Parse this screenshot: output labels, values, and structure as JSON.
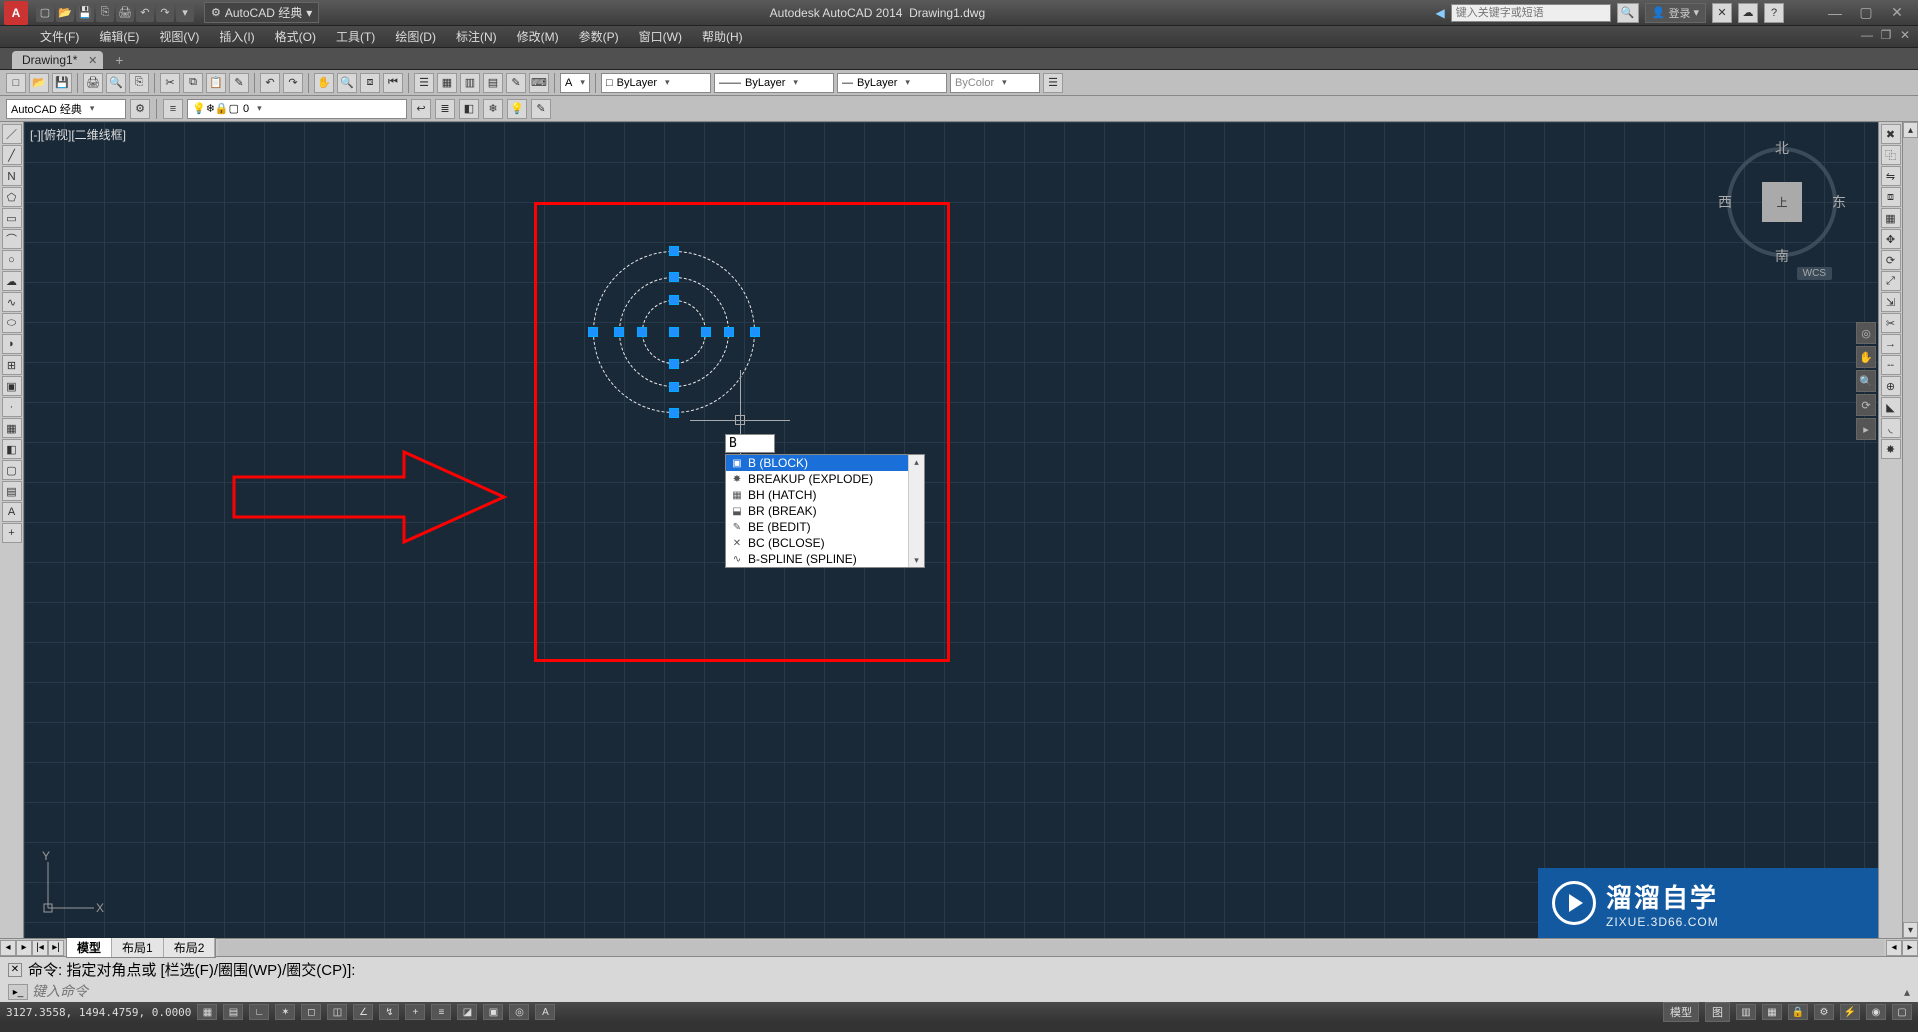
{
  "title": {
    "app": "Autodesk AutoCAD 2014",
    "doc": "Drawing1.dwg"
  },
  "workspace": "AutoCAD 经典",
  "search_placeholder": "键入关键字或短语",
  "sign_in": "登录",
  "menus": [
    "文件(F)",
    "编辑(E)",
    "视图(V)",
    "插入(I)",
    "格式(O)",
    "工具(T)",
    "绘图(D)",
    "标注(N)",
    "修改(M)",
    "参数(P)",
    "窗口(W)",
    "帮助(H)"
  ],
  "doc_tab": "Drawing1*",
  "layer_dd": "0",
  "color_dd": "ByLayer",
  "linetype_dd": "ByLayer",
  "lineweight_dd": "ByLayer",
  "plotstyle_dd": "ByColor",
  "style_dd": "AutoCAD 经典",
  "viewport_label": "[-][俯视][二维线框]",
  "viewcube": {
    "top": "上",
    "n": "北",
    "s": "南",
    "e": "东",
    "w": "西",
    "wcs": "WCS"
  },
  "model_tabs": [
    "模型",
    "布局1",
    "布局2"
  ],
  "cmd_history": "命令: 指定对角点或 [栏选(F)/圈围(WP)/圈交(CP)]:",
  "cmd_placeholder": "键入命令",
  "coords": "3127.3558, 1494.4759, 0.0000",
  "status_right": {
    "tab1": "模型",
    "tab2": "图"
  },
  "dyn_input_value": "B",
  "autocomplete": [
    {
      "label": "B (BLOCK)",
      "sel": true
    },
    {
      "label": "BREAKUP (EXPLODE)",
      "sel": false
    },
    {
      "label": "BH (HATCH)",
      "sel": false
    },
    {
      "label": "BR (BREAK)",
      "sel": false
    },
    {
      "label": "BE (BEDIT)",
      "sel": false
    },
    {
      "label": "BC (BCLOSE)",
      "sel": false
    },
    {
      "label": "B-SPLINE (SPLINE)",
      "sel": false
    }
  ],
  "watermark": {
    "line1": "溜溜自学",
    "line2": "ZIXUE.3D66.COM"
  }
}
